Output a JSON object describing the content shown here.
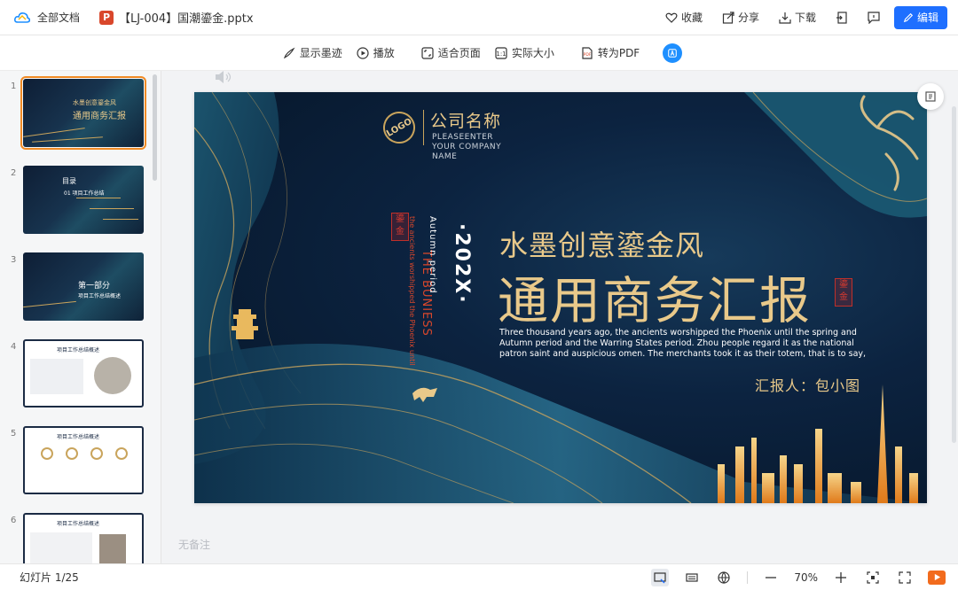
{
  "topbar": {
    "all_docs": "全部文档",
    "file_name": "【LJ-004】国潮鎏金.pptx",
    "favorite": "收藏",
    "share": "分享",
    "download": "下载",
    "edit": "编辑"
  },
  "toolbar": {
    "show_ink": "显示墨迹",
    "play": "播放",
    "fit_page": "适合页面",
    "actual_size": "实际大小",
    "to_pdf": "转为PDF"
  },
  "thumbnails": [
    {
      "num": "1",
      "line1": "水墨创意鎏金风",
      "line2": "通用商务汇报"
    },
    {
      "num": "2",
      "line1": "目录",
      "line2": "01 项目工作总结"
    },
    {
      "num": "3",
      "line1": "第一部分",
      "line2": "项目工作总结概述"
    },
    {
      "num": "4",
      "line1": "项目工作总结概述",
      "line2": ""
    },
    {
      "num": "5",
      "line1": "项目工作总结概述",
      "line2": ""
    },
    {
      "num": "6",
      "line1": "项目工作总结概述",
      "line2": ""
    }
  ],
  "slide": {
    "logo": "LOGO",
    "company": "公司名称",
    "company_sub": "PLEASEENTER YOUR COMPANY NAME",
    "year": "·202X·",
    "autumn": "Autumn period",
    "buniess": "THE BUNIESS",
    "ancients": "the ancients worshipped the Phoenix until",
    "seal_left": "鎏金",
    "seal_right": "鎏金",
    "title_small": "水墨创意鎏金风",
    "title_large": "通用商务汇报",
    "body": "Three thousand years ago, the ancients worshipped the Phoenix until the spring and Autumn period and the Warring States period. Zhou people regard it as the national patron saint and auspicious omen. The merchants took it as their totem, that is to say,",
    "reporter": "汇报人：包小图"
  },
  "notes_placeholder": "无备注",
  "status": {
    "slide_counter": "幻灯片 1/25",
    "zoom": "70%"
  },
  "colors": {
    "accent": "#1e6fff",
    "gold": "#e9c98a",
    "navy": "#0c2340",
    "active_thumb": "#f08a24"
  }
}
